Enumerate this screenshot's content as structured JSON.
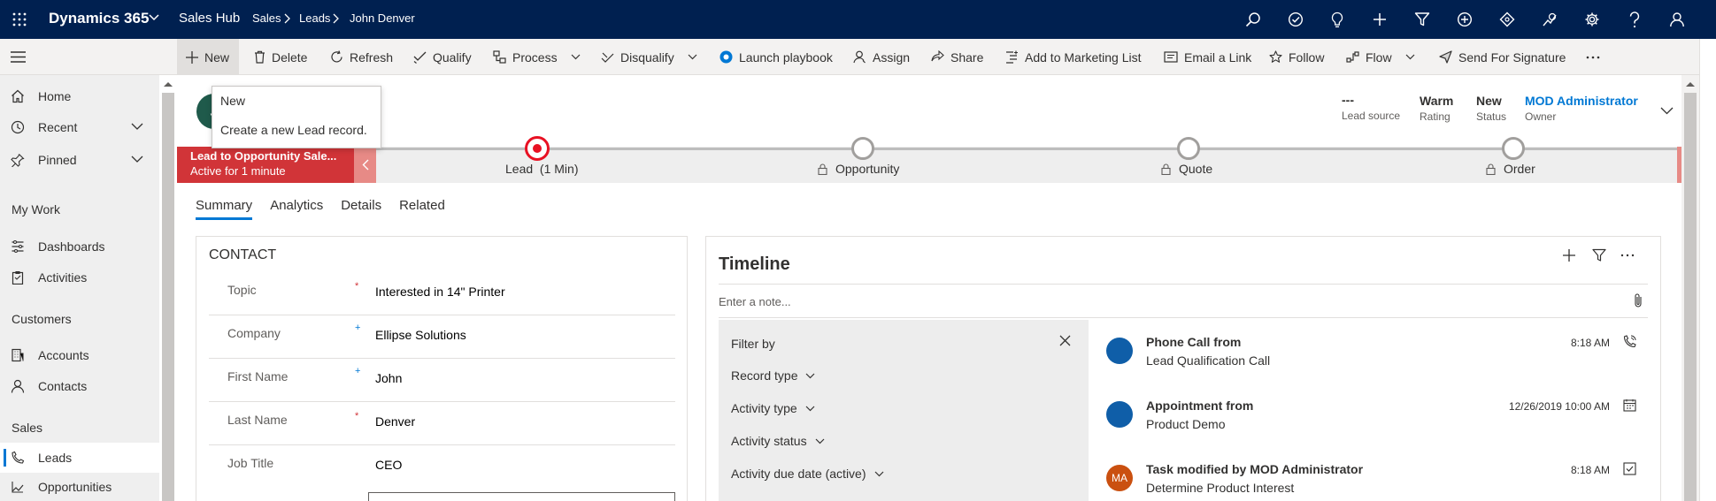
{
  "app": {
    "name": "Dynamics 365",
    "area": "Sales Hub"
  },
  "breadcrumb": [
    "Sales",
    "Leads",
    "John Denver"
  ],
  "commands": {
    "new": "New",
    "delete": "Delete",
    "refresh": "Refresh",
    "qualify": "Qualify",
    "process": "Process",
    "disqualify": "Disqualify",
    "launch_playbook": "Launch playbook",
    "assign": "Assign",
    "share": "Share",
    "add_marketing": "Add to Marketing List",
    "email_link": "Email a Link",
    "follow": "Follow",
    "flow": "Flow",
    "send_signature": "Send For Signature"
  },
  "tooltip": {
    "title": "New",
    "description": "Create a new Lead record."
  },
  "nav": {
    "home": "Home",
    "recent": "Recent",
    "pinned": "Pinned",
    "my_work": "My Work",
    "dashboards": "Dashboards",
    "activities": "Activities",
    "customers": "Customers",
    "accounts": "Accounts",
    "contacts": "Contacts",
    "sales": "Sales",
    "leads": "Leads",
    "opportunities": "Opportunities"
  },
  "record": {
    "avatar_initial": "J",
    "header_fields": [
      {
        "value": "---",
        "label": "Lead source"
      },
      {
        "value": "Warm",
        "label": "Rating"
      },
      {
        "value": "New",
        "label": "Status"
      },
      {
        "value": "MOD Administrator",
        "label": "Owner"
      }
    ]
  },
  "bpf": {
    "process_name": "Lead to Opportunity Sale...",
    "active_for": "Active for 1 minute",
    "stages": [
      {
        "label": "Lead  (1 Min)",
        "active": true
      },
      {
        "label": "Opportunity",
        "locked": true
      },
      {
        "label": "Quote",
        "locked": true
      },
      {
        "label": "Order",
        "locked": true
      }
    ]
  },
  "tabs": [
    "Summary",
    "Analytics",
    "Details",
    "Related"
  ],
  "contact": {
    "section_title": "CONTACT",
    "fields": [
      {
        "label": "Topic",
        "req": "*",
        "value": "Interested in 14\" Printer"
      },
      {
        "label": "Company",
        "req": "+",
        "value": "Ellipse Solutions"
      },
      {
        "label": "First Name",
        "req": "+",
        "value": "John"
      },
      {
        "label": "Last Name",
        "req": "*",
        "value": "Denver"
      },
      {
        "label": "Job Title",
        "req": "",
        "value": "CEO"
      }
    ]
  },
  "timeline": {
    "title": "Timeline",
    "note_placeholder": "Enter a note...",
    "filter_by": "Filter by",
    "filters": [
      "Record type",
      "Activity type",
      "Activity status",
      "Activity due date (active)"
    ],
    "items": [
      {
        "title": "Phone Call from",
        "sub": "Lead Qualification Call",
        "time": "8:18 AM",
        "avatar": "",
        "icon": "phone-icon"
      },
      {
        "title": "Appointment from",
        "sub": "Product Demo",
        "time": "12/26/2019 10:00 AM",
        "avatar": "",
        "icon": "calendar-icon"
      },
      {
        "title": "Task modified by MOD Administrator",
        "sub": "Determine Product Interest",
        "time": "8:18 AM",
        "avatar": "MA",
        "icon": "checkbox-icon"
      }
    ]
  },
  "colors": {
    "navy": "#002050",
    "accent": "#0078d4",
    "bpf_red": "#d13438",
    "bpf_active": "#e81123"
  }
}
